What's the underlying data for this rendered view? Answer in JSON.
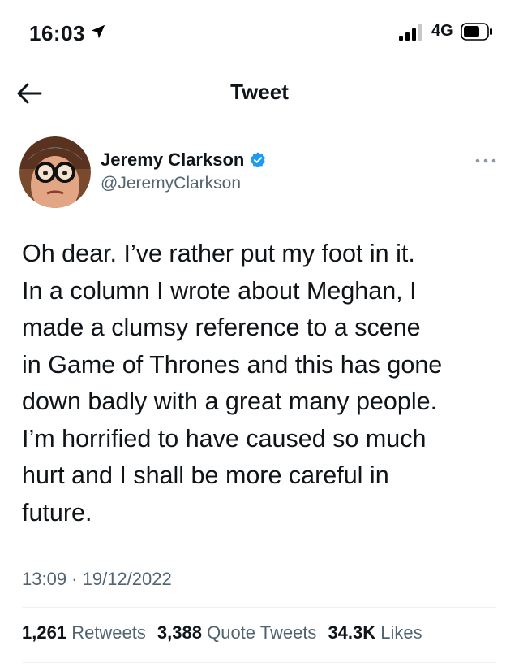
{
  "status_bar": {
    "time": "16:03",
    "network": "4G",
    "icons": [
      "location-arrow-icon",
      "signal-bars-icon",
      "battery-icon"
    ]
  },
  "header": {
    "title": "Tweet",
    "back_icon": "back-arrow-icon"
  },
  "author": {
    "display_name": "Jeremy Clarkson",
    "handle": "@JeremyClarkson",
    "verified": true,
    "verified_color": "#1d9bf0"
  },
  "tweet": {
    "lines": [
      "Oh dear. I’ve rather put my foot in it.",
      "In a column I wrote about Meghan, I",
      "made a clumsy reference to a scene",
      "in Game of Thrones and this has gone",
      "down badly with a great many people.",
      "I’m horrified to have caused so much",
      "hurt and I shall be more careful in",
      "future."
    ],
    "time": "13:09 · 19/12/2022"
  },
  "stats": {
    "retweets_count": "1,261",
    "retweets_label": "Retweets",
    "quotes_count": "3,388",
    "quotes_label": "Quote Tweets",
    "likes_count": "34.3K",
    "likes_label": "Likes"
  },
  "colors": {
    "text_primary": "#0f1419",
    "text_secondary": "#536471",
    "divider": "#eff3f4"
  }
}
